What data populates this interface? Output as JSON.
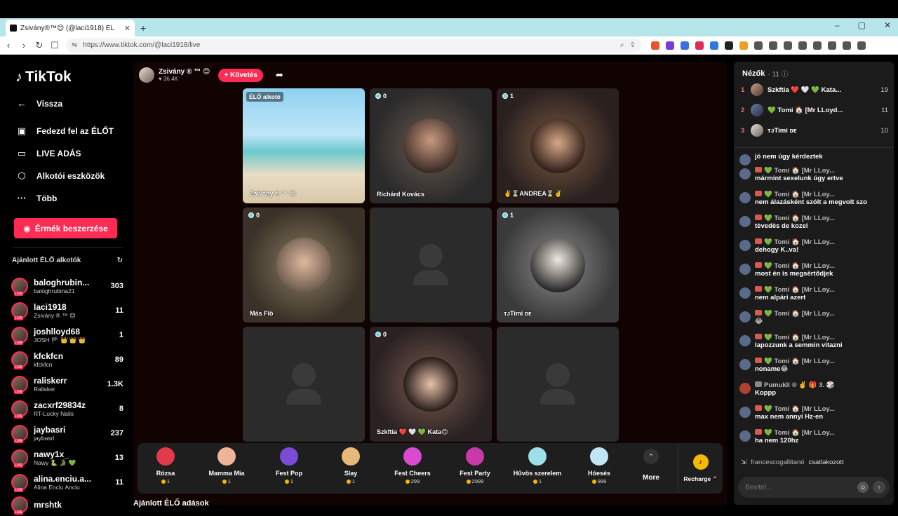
{
  "browser": {
    "tab_title": "Zsivány®™😊 (@laci1918) ÉL",
    "url": "https://www.tiktok.com/@laci1918/live",
    "new_tab": "+",
    "win_min": "–",
    "win_max": "▢",
    "win_close": "✕"
  },
  "sidebar": {
    "logo": "TikTok",
    "nav": [
      {
        "label": "Vissza",
        "icon": "←"
      },
      {
        "label": "Fedezd fel az ÉLŐT",
        "icon": "▣"
      },
      {
        "label": "LIVE ADÁS",
        "icon": "▭"
      },
      {
        "label": "Alkotói eszközök",
        "icon": "⬡"
      },
      {
        "label": "Több",
        "icon": "···"
      }
    ],
    "coins_button": "Érmék beszerzése",
    "recommended_title": "Ajánlott ÉLŐ alkotók",
    "refresh_icon": "↻",
    "creators": [
      {
        "name": "baloghrubin...",
        "handle": "baloghrubina21",
        "count": "303"
      },
      {
        "name": "laci1918",
        "handle": "Zsivány ® ™ 😊",
        "count": "11"
      },
      {
        "name": "joshlloyd68",
        "handle": "JOSH 🏴 👑 👑 👑",
        "count": "1"
      },
      {
        "name": "kfckfcn",
        "handle": "kfckfcn",
        "count": "89"
      },
      {
        "name": "raliskerr",
        "handle": "Ralisker",
        "count": "1.3K"
      },
      {
        "name": "zacxrf29834z",
        "handle": "RT-Lucky Nails",
        "count": "8"
      },
      {
        "name": "jaybasri",
        "handle": "jaybasri",
        "count": "237"
      },
      {
        "name": "nawy1x_",
        "handle": "Nawy 🐍 🐊 💚",
        "count": "13"
      },
      {
        "name": "alina.enciu.a...",
        "handle": "Alina Enciu Anciu",
        "count": "11"
      },
      {
        "name": "mrshtk",
        "handle": "",
        "count": ""
      }
    ]
  },
  "stage": {
    "host_name": "Zsivány ® ™ 😊",
    "host_likes": "♥ 36.4K",
    "follow": "+ Követés",
    "share_icon": "➦",
    "creator_tag": "ÉLŐ alkotó",
    "tiles": [
      {
        "name": "Zsivány ® ™ 😊",
        "badge": ""
      },
      {
        "name": "Richárd Kovács",
        "badge": "0"
      },
      {
        "name": "✌️⌛ANDREA⌛✌️",
        "badge": "1"
      },
      {
        "name": "Más Flö",
        "badge": "0"
      },
      {
        "name": "",
        "badge": ""
      },
      {
        "name": "ᴛᴊTimi ᴅᴇ",
        "badge": "1"
      },
      {
        "name": "",
        "badge": ""
      },
      {
        "name": "Szkftia ❤️ 🤍 💚 Kata😊",
        "badge": "0"
      },
      {
        "name": "",
        "badge": ""
      }
    ],
    "below_title": "Ajánlott ÉLŐ adások"
  },
  "gifts": [
    {
      "name": "Rózsa",
      "price": "1",
      "color": "#e23a4a"
    },
    {
      "name": "Mamma Mia",
      "price": "1",
      "color": "#f0b49a"
    },
    {
      "name": "Fest Pop",
      "price": "1",
      "color": "#7b4ad6"
    },
    {
      "name": "Slay",
      "price": "1",
      "color": "#e8b87a"
    },
    {
      "name": "Fest Cheers",
      "price": "299",
      "color": "#d84ad0"
    },
    {
      "name": "Fest Party",
      "price": "2999",
      "color": "#c83aa8"
    },
    {
      "name": "Hűvös szerelem",
      "price": "1",
      "color": "#9ee0ea"
    },
    {
      "name": "Hóesés",
      "price": "999",
      "color": "#bfe6f5"
    }
  ],
  "more_label": "More",
  "more_icon": "⌃",
  "recharge_label": "Recharge ⌃",
  "recharge_icon": "♪",
  "chat": {
    "title": "Nézők",
    "viewer_count": "· 11 ⓘ",
    "viewers": [
      {
        "rank": "1",
        "name": "Szkftia ❤️ 🤍 💚 Kata...",
        "score": "19"
      },
      {
        "rank": "2",
        "name": "💚 Tomi 🏠 [Mr LLoyd...",
        "score": "11"
      },
      {
        "rank": "3",
        "name": "ᴛᴊTimi ᴅᴇ",
        "score": "10"
      }
    ],
    "messages": [
      {
        "user": "",
        "text": "jó nem úgy kérdeztek"
      },
      {
        "user": "💚 Tomi 🏠 [Mr LLoy...",
        "text": "mármint sexelunk úgy ertve"
      },
      {
        "user": "💚 Tomi 🏠 [Mr LLoy...",
        "text": "nem álazásként szólt a megvolt szo"
      },
      {
        "user": "💚 Tomi 🏠 [Mr LLoy...",
        "text": "tèvedès de kozel"
      },
      {
        "user": "💚 Tomi 🏠 [Mr LLoy...",
        "text": "dehogy K..va!"
      },
      {
        "user": "💚 Tomi 🏠 [Mr LLoy...",
        "text": "most én is megsèrtődjek"
      },
      {
        "user": "💚 Tomi 🏠 [Mr LLoy...",
        "text": "nem alpári azert"
      },
      {
        "user": "💚 Tomi 🏠 [Mr LLoy...",
        "text": "😂"
      },
      {
        "user": "💚 Tomi 🏠 [Mr LLoy...",
        "text": "lapozzunk a semmin vitazni"
      },
      {
        "user": "💚 Tomi 🏠 [Mr LLoy...",
        "text": "noname😂"
      },
      {
        "user": "Pumukli ® ✌️ 🎁 3. 🎲",
        "text": "Koppp"
      },
      {
        "user": "💚 Tomi 🏠 [Mr LLoy...",
        "text": "max nem annyi Hz-en"
      },
      {
        "user": "💚 Tomi 🏠 [Mr LLoy...",
        "text": "ha nem 120hz"
      }
    ],
    "joined_user": "francescogallitanó",
    "joined_text": "csatlakozott",
    "input_placeholder": "Bevitel...",
    "emoji_icon": "☺",
    "send_icon": "↑"
  }
}
